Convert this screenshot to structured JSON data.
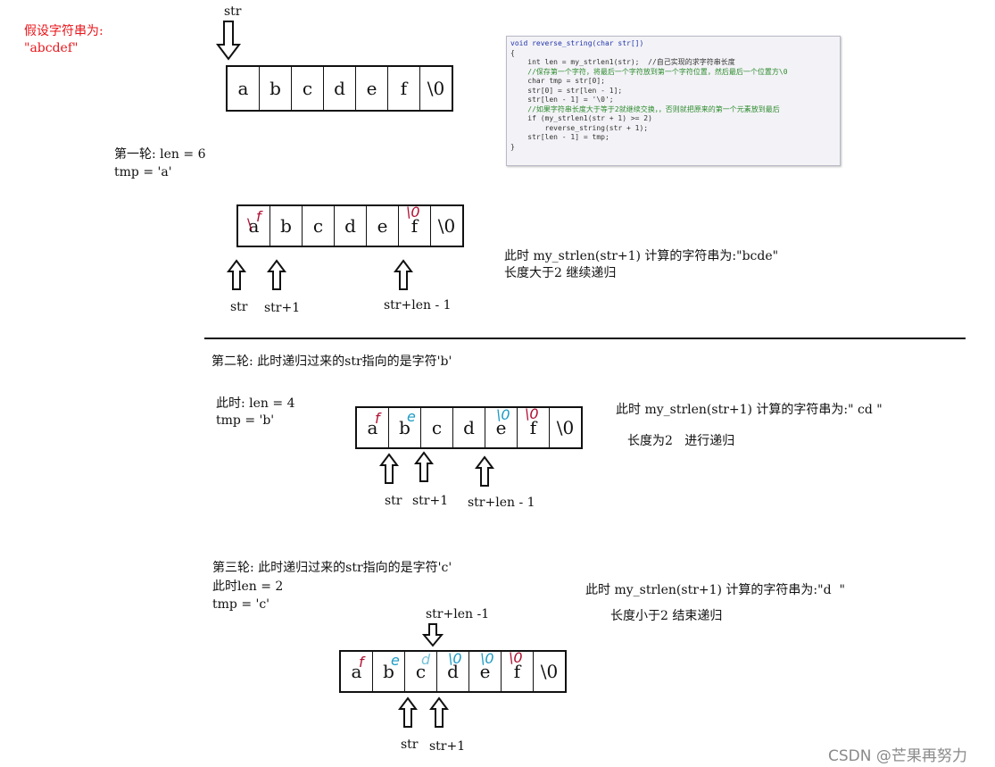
{
  "assume": {
    "title": "假设字符串为:",
    "value": "\"abcdef\""
  },
  "top_pointer": "str",
  "code_lines": [
    "void reverse_string(char str[])",
    "{",
    "    int len = my_strlen1(str);  //自己实现的求字符串长度",
    "    //保存第一个字符，将最后一个字符放到第一个字符位置，然后最后一个位置方\\0",
    "    char tmp = str[0];",
    "    str[0] = str[len - 1];",
    "    str[len - 1] = '\\0';",
    "    //如果字符串长度大于等于2就继续交换，，否则就把原来的第一个元素放到最后",
    "    if (my_strlen1(str + 1) >= 2)",
    "        reverse_string(str + 1);",
    "    str[len - 1] = tmp;",
    "}"
  ],
  "initial_cells": [
    "a",
    "b",
    "c",
    "d",
    "e",
    "f",
    "\\0"
  ],
  "round1": {
    "line1": "第一轮: len = 6",
    "line2": "tmp = 'a'",
    "cells": [
      "a",
      "b",
      "c",
      "d",
      "e",
      "f",
      "\\0"
    ],
    "ptr_str": "str",
    "ptr_str1": "str+1",
    "ptr_end": "str+len - 1",
    "note1": "此时 my_strlen(str+1) 计算的字符串为:\"bcde\"",
    "note2": "长度大于2 继续递归"
  },
  "round2": {
    "heading": "第二轮: 此时递归过来的str指向的是字符'b'",
    "line1": "此时: len = 4",
    "line2": "tmp = 'b'",
    "cells": [
      "a",
      "b",
      "c",
      "d",
      "e",
      "f",
      "\\0"
    ],
    "ptr_str": "str",
    "ptr_str1": "str+1",
    "ptr_end": "str+len - 1",
    "note1": "此时 my_strlen(str+1) 计算的字符串为:\" cd \"",
    "note2": "长度为2   进行递归"
  },
  "round3": {
    "heading": "第三轮: 此时递归过来的str指向的是字符'c'",
    "line1": "此时len = 2",
    "line2": "tmp = 'c'",
    "cells": [
      "a",
      "b",
      "c",
      "d",
      "e",
      "f",
      "\\0"
    ],
    "ptr_end": "str+len -1",
    "ptr_str": "str",
    "ptr_str1": "str+1",
    "note1": "此时 my_strlen(str+1) 计算的字符串为:\"d  \"",
    "note2": "长度小于2 结束递归"
  },
  "watermark": "CSDN @芒果再努力",
  "colors": {
    "red_text": "#e8161b",
    "mark_red": "#b01032",
    "mark_cyan": "#1d9bc4"
  }
}
